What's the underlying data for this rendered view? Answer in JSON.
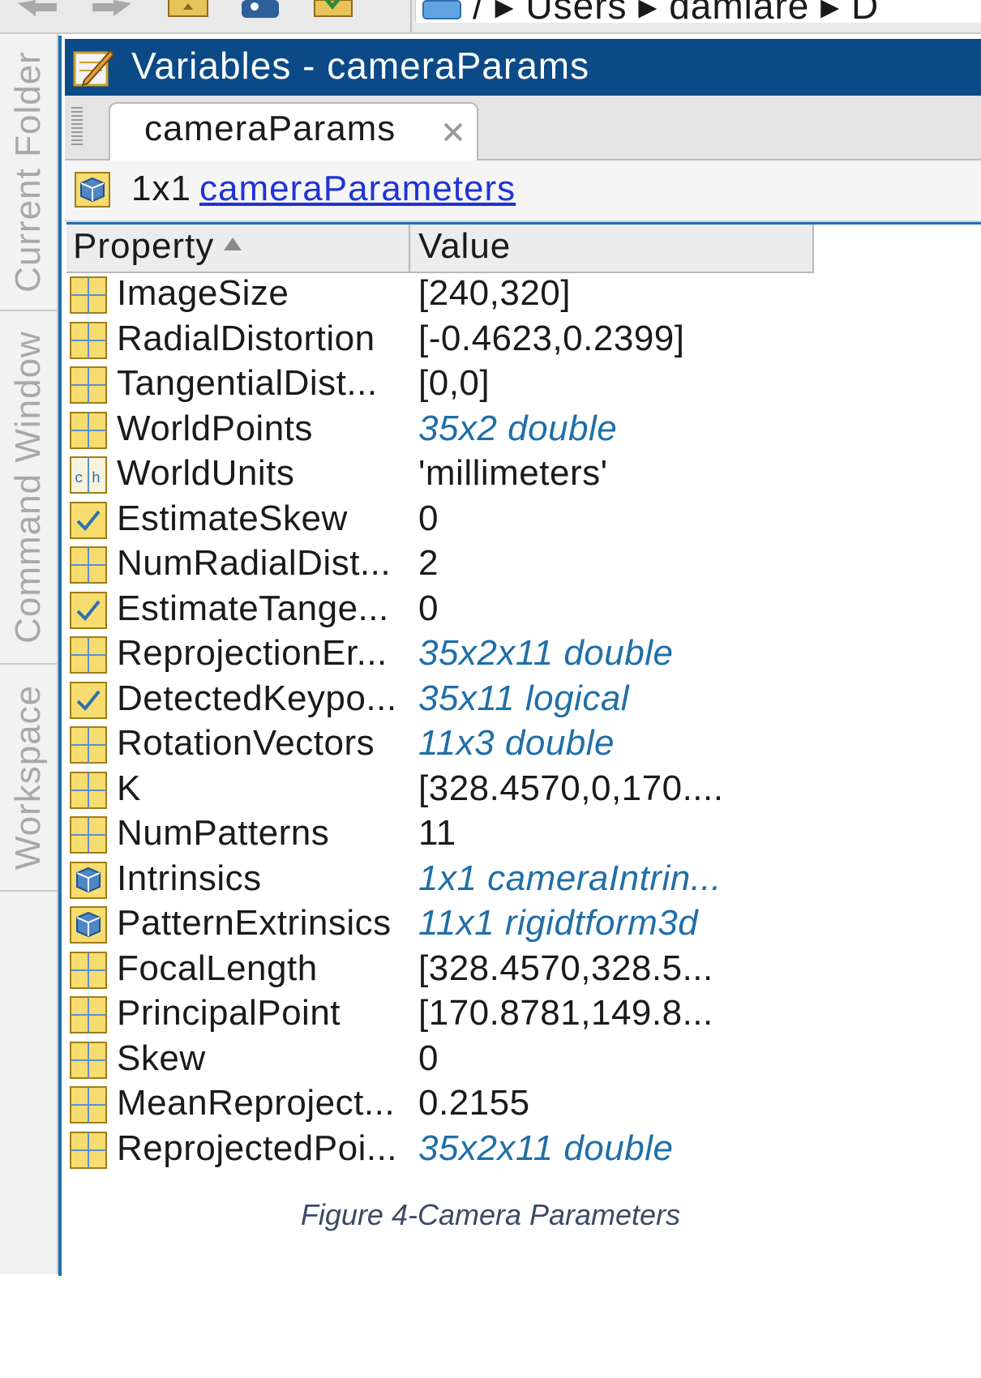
{
  "address_bar": {
    "path": "/ ▸ Users ▸ damiare ▸ D"
  },
  "sidebar": {
    "tabs": [
      {
        "label": "Current Folder"
      },
      {
        "label": "Command Window"
      },
      {
        "label": "Workspace"
      }
    ]
  },
  "panel": {
    "title": "Variables - cameraParams",
    "tab_label": "cameraParams",
    "info_size": "1x1",
    "info_class": "cameraParameters"
  },
  "table": {
    "headers": {
      "property": "Property",
      "value": "Value"
    },
    "rows": [
      {
        "icon": "grid-icon",
        "property": "ImageSize",
        "value": "[240,320]",
        "link": false
      },
      {
        "icon": "grid-icon",
        "property": "RadialDistortion",
        "value": "[-0.4623,0.2399]",
        "link": false
      },
      {
        "icon": "grid-icon",
        "property": "TangentialDist...",
        "value": "[0,0]",
        "link": false
      },
      {
        "icon": "grid-icon",
        "property": "WorldPoints",
        "value": "35x2 double",
        "link": true
      },
      {
        "icon": "char-icon",
        "property": "WorldUnits",
        "value": "'millimeters'",
        "link": false
      },
      {
        "icon": "logical-icon",
        "property": "EstimateSkew",
        "value": "0",
        "link": false
      },
      {
        "icon": "grid-icon",
        "property": "NumRadialDist...",
        "value": "2",
        "link": false
      },
      {
        "icon": "logical-icon",
        "property": "EstimateTange...",
        "value": "0",
        "link": false
      },
      {
        "icon": "grid-icon",
        "property": "ReprojectionEr...",
        "value": "35x2x11 double",
        "link": true
      },
      {
        "icon": "logical-icon",
        "property": "DetectedKeypo...",
        "value": "35x11 logical",
        "link": true
      },
      {
        "icon": "grid-icon",
        "property": "RotationVectors",
        "value": "11x3 double",
        "link": true
      },
      {
        "icon": "grid-icon",
        "property": "K",
        "value": "[328.4570,0,170....",
        "link": false
      },
      {
        "icon": "grid-icon",
        "property": "NumPatterns",
        "value": "11",
        "link": false
      },
      {
        "icon": "object-icon",
        "property": "Intrinsics",
        "value": "1x1 cameraIntrin...",
        "link": true
      },
      {
        "icon": "object-icon",
        "property": "PatternExtrinsics",
        "value": "11x1 rigidtform3d",
        "link": true
      },
      {
        "icon": "grid-icon",
        "property": "FocalLength",
        "value": "[328.4570,328.5...",
        "link": false
      },
      {
        "icon": "grid-icon",
        "property": "PrincipalPoint",
        "value": "[170.8781,149.8...",
        "link": false
      },
      {
        "icon": "grid-icon",
        "property": "Skew",
        "value": "0",
        "link": false
      },
      {
        "icon": "grid-icon",
        "property": "MeanReproject...",
        "value": "0.2155",
        "link": false
      },
      {
        "icon": "grid-icon",
        "property": "ReprojectedPoi...",
        "value": "35x2x11 double",
        "link": true
      }
    ]
  },
  "caption": "Figure 4-Camera Parameters",
  "colors": {
    "title_bar": "#0b4a86",
    "accent_border": "#1f6fb5",
    "link_value": "#1f6fa8",
    "hyperlink": "#1f33d6",
    "icon_fill": "#f7dc6f"
  }
}
